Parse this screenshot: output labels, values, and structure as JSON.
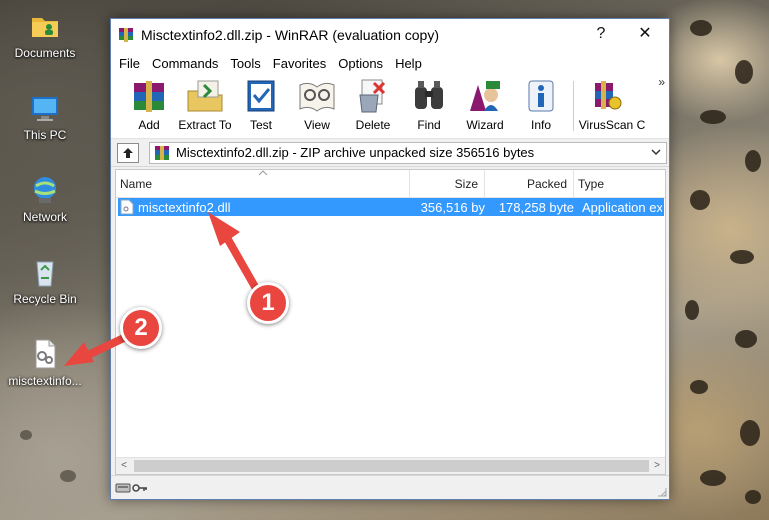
{
  "desktop": {
    "icons": [
      {
        "label": "Documents",
        "icon": "documents-folder-icon"
      },
      {
        "label": "This PC",
        "icon": "computer-icon"
      },
      {
        "label": "Network",
        "icon": "network-icon"
      },
      {
        "label": "Recycle Bin",
        "icon": "recycle-bin-icon"
      },
      {
        "label": "misctextinfo...",
        "icon": "dll-file-icon"
      }
    ]
  },
  "window": {
    "title": "Misctextinfo2.dll.zip - WinRAR (evaluation copy)",
    "help_button": "?",
    "close_button": "✕",
    "menu": [
      "File",
      "Commands",
      "Tools",
      "Favorites",
      "Options",
      "Help"
    ],
    "toolbar": [
      {
        "label": "Add",
        "icon": "add-icon"
      },
      {
        "label": "Extract To",
        "icon": "extract-to-icon"
      },
      {
        "label": "Test",
        "icon": "test-icon"
      },
      {
        "label": "View",
        "icon": "view-icon"
      },
      {
        "label": "Delete",
        "icon": "delete-icon"
      },
      {
        "label": "Find",
        "icon": "find-icon"
      },
      {
        "label": "Wizard",
        "icon": "wizard-icon"
      },
      {
        "label": "Info",
        "icon": "info-icon"
      },
      {
        "label": "VirusScan",
        "icon": "virusscan-icon"
      },
      {
        "label": "C",
        "icon": "comment-icon"
      }
    ],
    "toolbar_overflow": "»",
    "address": "Misctextinfo2.dll.zip - ZIP archive unpacked size 356516 bytes",
    "columns": [
      "Name",
      "Size",
      "Packed",
      "Type"
    ],
    "files": [
      {
        "name": "misctextinfo2.dll",
        "size": "356,516 by",
        "packed": "178,258 byte",
        "type": "Application exte",
        "selected": true
      }
    ],
    "scroll_left": "<",
    "scroll_right": ">"
  },
  "annotations": {
    "step1": "1",
    "step2": "2",
    "arrow_color": "#e8463f"
  }
}
